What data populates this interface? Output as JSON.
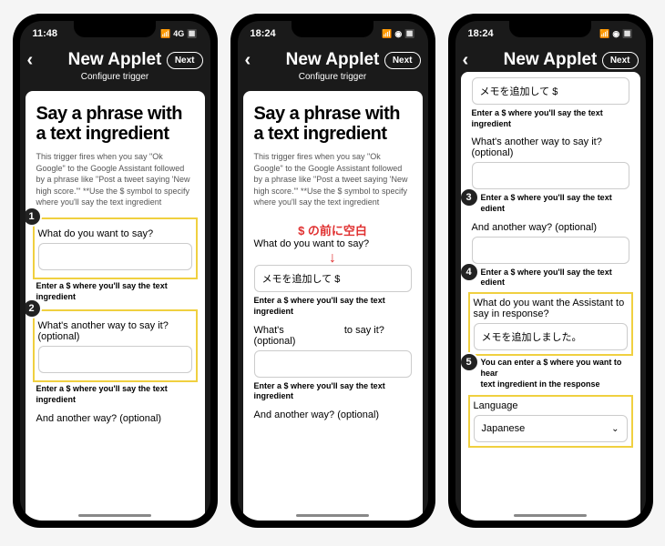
{
  "screens": [
    {
      "time": "11:48",
      "signal": "4G",
      "header_title": "New Applet",
      "next": "Next",
      "subtitle": "Configure trigger",
      "card_title": "Say a phrase with a text ingredient",
      "card_desc": "This trigger fires when you say \"Ok Google\" to the Google Assistant followed by a phrase like \"Post a tweet saying 'New high score.'\" **Use the $ symbol to specify where you'll say the text ingredient",
      "field1_label": "What do you want to say?",
      "field1_value": "",
      "hint1": "Enter a $ where you'll say the text ingredient",
      "field2_label": "What's another way to say it? (optional)",
      "field2_value": "",
      "hint2": "Enter a $ where you'll say the text ingredient",
      "field3_label": "And another way? (optional)",
      "badge1": "1",
      "badge2": "2"
    },
    {
      "time": "18:24",
      "header_title": "New Applet",
      "next": "Next",
      "subtitle": "Configure trigger",
      "card_title": "Say a phrase with a text ingredient",
      "card_desc": "This trigger fires when you say \"Ok Google\" to the Google Assistant followed by a phrase like \"Post a tweet saying 'New high score.'\" **Use the $ symbol to specify where you'll say the text ingredient",
      "annotation": "$ の前に空白",
      "field1_label": "What do you want to say?",
      "field1_value": "メモを追加して $",
      "hint1": "Enter a $ where you'll say the text ingredient",
      "field2_label_a": "What's",
      "field2_label_b": "to say it?",
      "field2_optional": "(optional)",
      "field2_value": "",
      "hint2": "Enter a $ where you'll say the text ingredient",
      "field3_label": "And another way? (optional)"
    },
    {
      "time": "18:24",
      "header_title": "New Applet",
      "next": "Next",
      "field0_value": "メモを追加して $",
      "hint0": "Enter a $ where you'll say the text ingredient",
      "field1_label": "What's another way to say it? (optional)",
      "field1_value": "",
      "hint1_a": "Enter a $ where you'll say the text",
      "hint1_b": "edient",
      "field2_label": "And another way? (optional)",
      "field2_value": "",
      "hint2_a": "Enter a $ where you'll say the text",
      "hint2_b": "edient",
      "field3_label": "What do you want the Assistant to say in response?",
      "field3_value": "メモを追加しました。",
      "hint3_a": "You can enter a $ where you want to hear",
      "hint3_b": "text ingredient in the response",
      "field4_label": "Language",
      "field4_value": "Japanese",
      "badge3": "3",
      "badge4": "4",
      "badge5": "5"
    }
  ]
}
